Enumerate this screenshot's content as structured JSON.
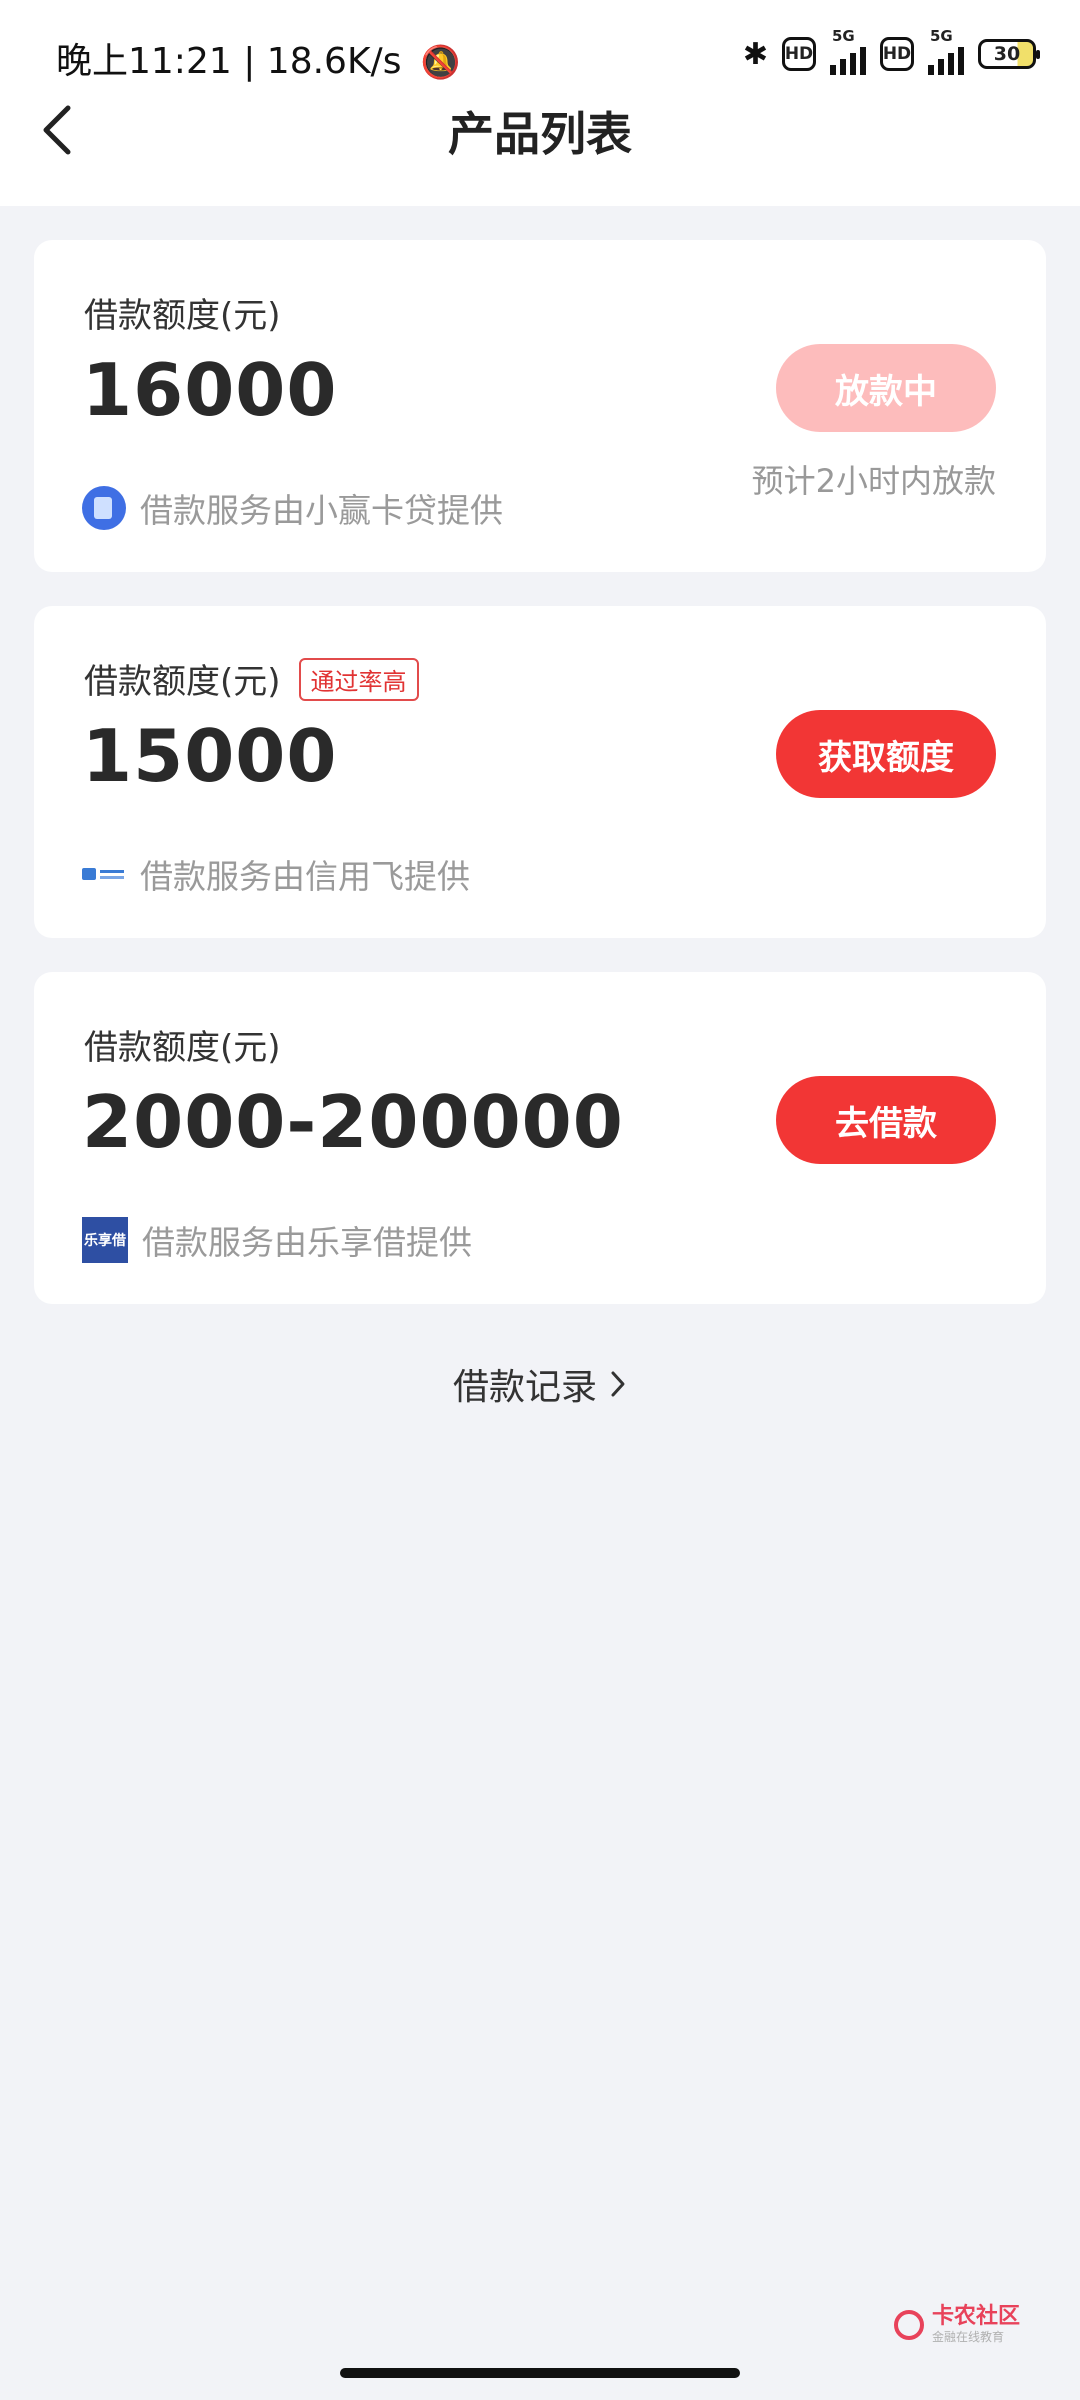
{
  "status_bar": {
    "time": "晚上11:21",
    "separator": "|",
    "net_speed": "18.6K/s",
    "network1": "5G",
    "network2": "5G",
    "hd": "HD",
    "battery": "30"
  },
  "header": {
    "title": "产品列表"
  },
  "cards": [
    {
      "label": "借款额度(元)",
      "amount": "16000",
      "button": "放款中",
      "note": "预计2小时内放款",
      "provider": "借款服务由小赢卡贷提供"
    },
    {
      "label": "借款额度(元)",
      "tag": "通过率高",
      "amount": "15000",
      "button": "获取额度",
      "provider": "借款服务由信用飞提供"
    },
    {
      "label": "借款额度(元)",
      "amount": "2000-200000",
      "button": "去借款",
      "provider": "借款服务由乐享借提供",
      "logo_text": "乐享借"
    }
  ],
  "records_link": "借款记录",
  "watermark": {
    "title": "卡农社区",
    "subtitle": "金融在线教育"
  },
  "colors": {
    "accent_red": "#f23635",
    "pale_red": "#fdbcbc",
    "background": "#f2f3f7"
  }
}
